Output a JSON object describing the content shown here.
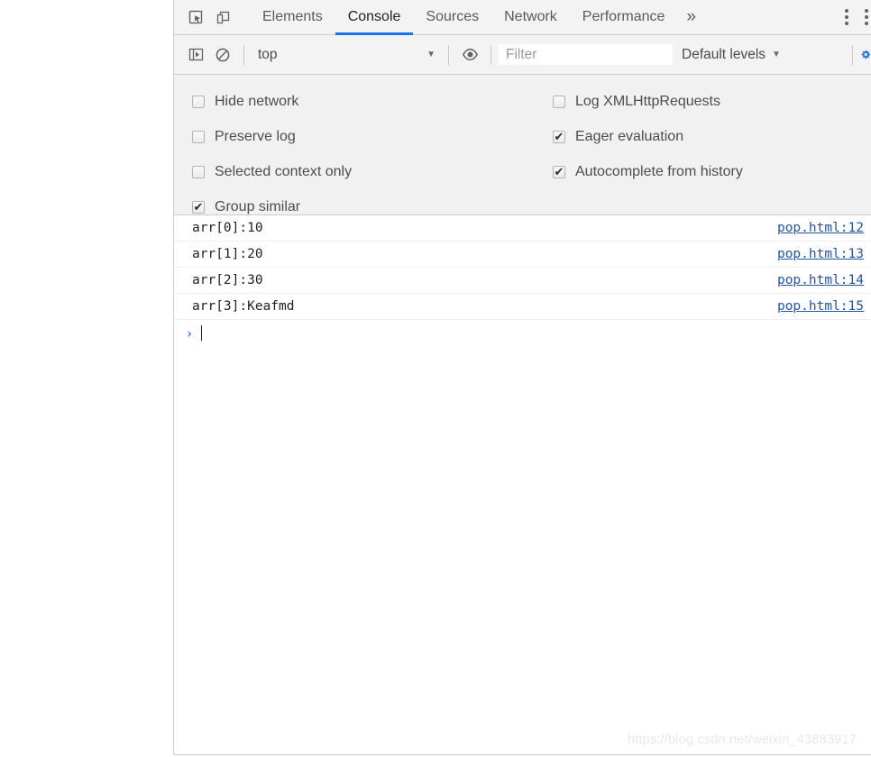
{
  "devtools": {
    "tabstrip": {
      "inspect_icon_name": "inspect-element-icon",
      "device_icon_name": "device-toolbar-icon",
      "tabs": [
        {
          "label": "Elements",
          "active": false
        },
        {
          "label": "Console",
          "active": true
        },
        {
          "label": "Sources",
          "active": false
        },
        {
          "label": "Network",
          "active": false
        },
        {
          "label": "Performance",
          "active": false
        }
      ],
      "more_tabs_glyph": "»",
      "active_tab_underline_color": "#1a73e8"
    },
    "console_toolbar": {
      "sidebar_toggle_name": "console-sidebar-toggle",
      "clear_console_name": "clear-console-icon",
      "context": "top",
      "context_caret": "▼",
      "eye_icon_name": "create-live-expression-icon",
      "filter_value": "",
      "filter_placeholder": "Filter",
      "levels_label": "Default levels",
      "levels_caret": "▼",
      "settings_gear_name": "console-settings-gear-icon",
      "settings_gear_color": "#1a73e8"
    },
    "settings_panel": {
      "left_column": [
        {
          "label": "Hide network",
          "checked": false
        },
        {
          "label": "Preserve log",
          "checked": false
        },
        {
          "label": "Selected context only",
          "checked": false
        },
        {
          "label": "Group similar",
          "checked": true
        }
      ],
      "right_column": [
        {
          "label": "Log XMLHttpRequests",
          "checked": false
        },
        {
          "label": "Eager evaluation",
          "checked": true
        },
        {
          "label": "Autocomplete from history",
          "checked": true
        }
      ],
      "check_glyph": "✔"
    },
    "console_messages": [
      {
        "text": "arr[0]:10",
        "source": "pop.html:12"
      },
      {
        "text": "arr[1]:20",
        "source": "pop.html:13"
      },
      {
        "text": "arr[2]:30",
        "source": "pop.html:14"
      },
      {
        "text": "arr[3]:Keafmd",
        "source": "pop.html:15"
      }
    ],
    "prompt": {
      "arrow": "›",
      "input_value": ""
    }
  },
  "watermark": "https://blog.csdn.net/weixin_43883917"
}
